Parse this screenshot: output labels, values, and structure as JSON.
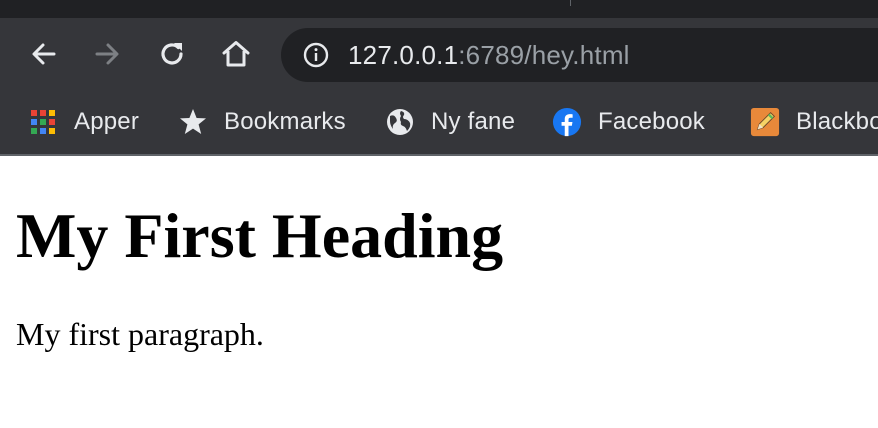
{
  "browser": {
    "address_bar": {
      "host": "127.0.0.1",
      "rest": ":6789/hey.html"
    },
    "nav": {
      "back_icon": "arrow-left-icon",
      "forward_icon": "arrow-right-icon",
      "reload_icon": "reload-icon",
      "home_icon": "home-icon",
      "site_info_icon": "info-icon"
    },
    "colors": {
      "chrome_dark": "#202124",
      "toolbar": "#35363a",
      "text_light": "#e8eaed",
      "text_dim": "#9aa0a6",
      "facebook_blue": "#1877f2"
    }
  },
  "bookmarks": [
    {
      "label": "Apper",
      "icon": "apps-grid-icon"
    },
    {
      "label": "Bookmarks",
      "icon": "star-icon"
    },
    {
      "label": "Ny fane",
      "icon": "globe-icon"
    },
    {
      "label": "Facebook",
      "icon": "facebook-icon"
    },
    {
      "label": "Blackbo",
      "icon": "pencil-icon"
    }
  ],
  "page": {
    "heading": "My First Heading",
    "paragraph": "My first paragraph."
  }
}
